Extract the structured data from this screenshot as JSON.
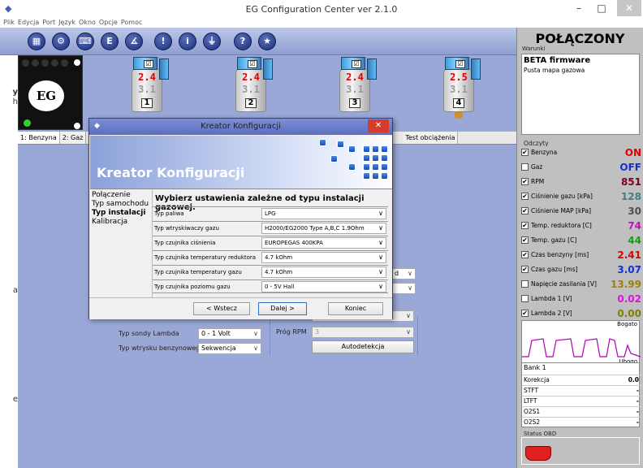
{
  "window": {
    "title": "EG Configuration Center ver 2.1.0",
    "minimize": "–",
    "maximize": "□",
    "close": "✕"
  },
  "menu": [
    "Plik",
    "Edycja",
    "Port",
    "Język",
    "Okno",
    "Opcje",
    "Pomoc"
  ],
  "toolbar": {
    "buttons": [
      {
        "icon": "grid-icon",
        "glyph": "▦"
      },
      {
        "icon": "gear-icon",
        "glyph": "⚙"
      },
      {
        "icon": "keyboard-icon",
        "glyph": "⌨"
      },
      {
        "icon": "e-icon",
        "glyph": "E"
      },
      {
        "icon": "angle-icon",
        "glyph": "∡"
      },
      {
        "icon": "warning-icon",
        "glyph": "!"
      },
      {
        "icon": "info-icon",
        "glyph": "i"
      },
      {
        "icon": "plug-icon",
        "glyph": "⏚"
      },
      {
        "icon": "help-icon",
        "glyph": "?"
      },
      {
        "icon": "star-icon",
        "glyph": "★"
      }
    ]
  },
  "left_strip": [
    "y",
    "h",
    "a",
    "e"
  ],
  "injectors": [
    {
      "top": "2.4",
      "bottom": "3.1",
      "num": "1"
    },
    {
      "top": "2.4",
      "bottom": "3.1",
      "num": "2"
    },
    {
      "top": "2.4",
      "bottom": "3.1",
      "num": "3"
    },
    {
      "top": "2.5",
      "bottom": "3.1",
      "num": "4"
    }
  ],
  "tabs": [
    "1: Benzyna",
    "2: Gaz",
    "Test obciążenia"
  ],
  "panel": {
    "lambda_type_label": "Typ sondy Lambda",
    "lambda_type_value": "0 - 1 Volt",
    "petrol_injection_label": "Typ wtrysku benzynowego",
    "petrol_injection_value": "Sekwencja",
    "rpm_threshold_label": "Próg RPM",
    "rpm_threshold_value": "3",
    "autodetect_button": "Autodetekcja",
    "hidden_combo_1": "d",
    "hidden_combo_2": ""
  },
  "wizard": {
    "title": "Kreator Konfiguracji",
    "banner_title": "Kreator Konfiguracji",
    "steps": [
      "Połączenie",
      "Typ samochodu",
      "Typ instalacji",
      "Kalibracja"
    ],
    "active_step": "Typ instalacji",
    "heading": "Wybierz ustawienia zależne od typu instalacji gazowej.",
    "fields": [
      {
        "label": "Typ paliwa",
        "value": "LPG"
      },
      {
        "label": "Typ wtryskiwaczy gazu",
        "value": "H2000/EG2000 Type A,B,C 1.9Ohm"
      },
      {
        "label": "Typ czujnika ciśnienia",
        "value": "EUROPEGAS 400KPA"
      },
      {
        "label": "Typ czujnika temperatury reduktora",
        "value": "4.7 kOhm"
      },
      {
        "label": "Typ czujnika temperatury gazu",
        "value": "4.7 kOhm"
      },
      {
        "label": "Typ czujnika poziomu gazu",
        "value": "0 - 5V Hall"
      }
    ],
    "back_button": "< Wstecz",
    "next_button": "Dalej >",
    "finish_button": "Koniec"
  },
  "side": {
    "status": "POŁĄCZONY",
    "conditions_label": "Warunki",
    "conditions_title": "BETA firmware",
    "conditions_text": "Pusta mapa gazowa",
    "readings_label": "Odczyty",
    "readings": [
      {
        "name": "Benzyna",
        "checked": true,
        "value": "ON",
        "color": "#e00000"
      },
      {
        "name": "Gaz",
        "checked": false,
        "value": "OFF",
        "color": "#1030d0"
      },
      {
        "name": "RPM",
        "checked": true,
        "value": "851",
        "color": "#800020"
      },
      {
        "name": "Ciśnienie gazu [kPa]",
        "checked": true,
        "value": "128",
        "color": "#408080"
      },
      {
        "name": "Ciśnienie MAP [kPa]",
        "checked": true,
        "value": "30",
        "color": "#505050"
      },
      {
        "name": "Temp. reduktora [C]",
        "checked": true,
        "value": "74",
        "color": "#c010c0"
      },
      {
        "name": "Temp. gazu [C]",
        "checked": true,
        "value": "44",
        "color": "#10a010"
      },
      {
        "name": "Czas benzyny [ms]",
        "checked": true,
        "value": "2.41",
        "color": "#e00000"
      },
      {
        "name": "Czas gazu [ms]",
        "checked": true,
        "value": "3.07",
        "color": "#1030d0"
      },
      {
        "name": "Napięcie zasilania [V]",
        "checked": false,
        "value": "13.99",
        "color": "#a08000"
      },
      {
        "name": "Lambda 1 [V]",
        "checked": false,
        "value": "0.02",
        "color": "#e010e0"
      },
      {
        "name": "Lambda 2 [V]",
        "checked": true,
        "value": "0.00",
        "color": "#808000"
      }
    ],
    "lambda_rich": "Bogato",
    "lambda_lean": "Ubogo",
    "bank_title": "Bank 1",
    "bank": [
      {
        "name": "Korekcja",
        "value": "0.0"
      },
      {
        "name": "STFT",
        "value": "-"
      },
      {
        "name": "LTFT",
        "value": "-"
      },
      {
        "name": "O2S1",
        "value": "-"
      },
      {
        "name": "O2S2",
        "value": "-"
      }
    ],
    "obd_label": "Status OBD"
  }
}
